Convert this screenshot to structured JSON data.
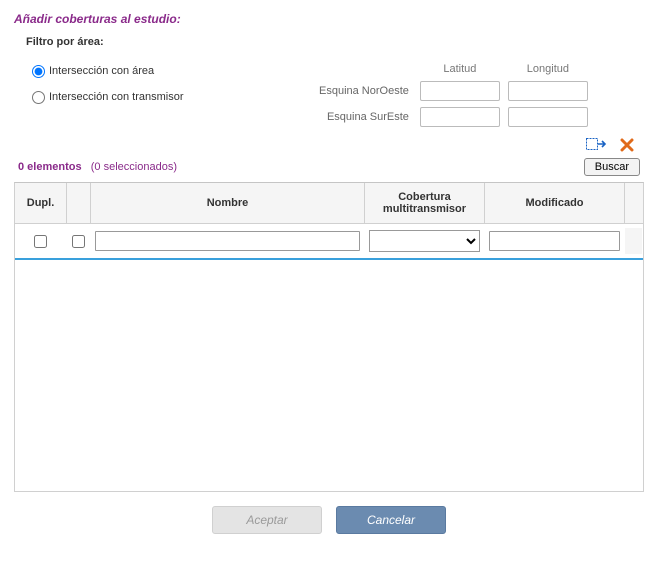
{
  "title": "Añadir coberturas al estudio:",
  "filter": {
    "heading": "Filtro por área:",
    "radio_area": "Intersección con área",
    "radio_tx": "Intersección con transmisor",
    "selected": "area",
    "cols": {
      "lat": "Latitud",
      "lon": "Longitud"
    },
    "rows": {
      "nw": "Esquina NorOeste",
      "se": "Esquina SurEste"
    },
    "values": {
      "nw_lat": "",
      "nw_lon": "",
      "se_lat": "",
      "se_lon": ""
    }
  },
  "icons": {
    "expand": "expand-selection-icon",
    "delete": "delete-icon"
  },
  "status": {
    "count_text": "0 elementos",
    "selected_text": "(0 seleccionados)"
  },
  "buttons": {
    "search": "Buscar",
    "accept": "Aceptar",
    "cancel": "Cancelar"
  },
  "grid": {
    "headers": {
      "dupl": "Dupl.",
      "nombre": "Nombre",
      "multi": "Cobertura multitransmisor",
      "modificado": "Modificado"
    },
    "filters": {
      "nombre": "",
      "multi_selected": "",
      "modificado": ""
    },
    "rows": []
  }
}
